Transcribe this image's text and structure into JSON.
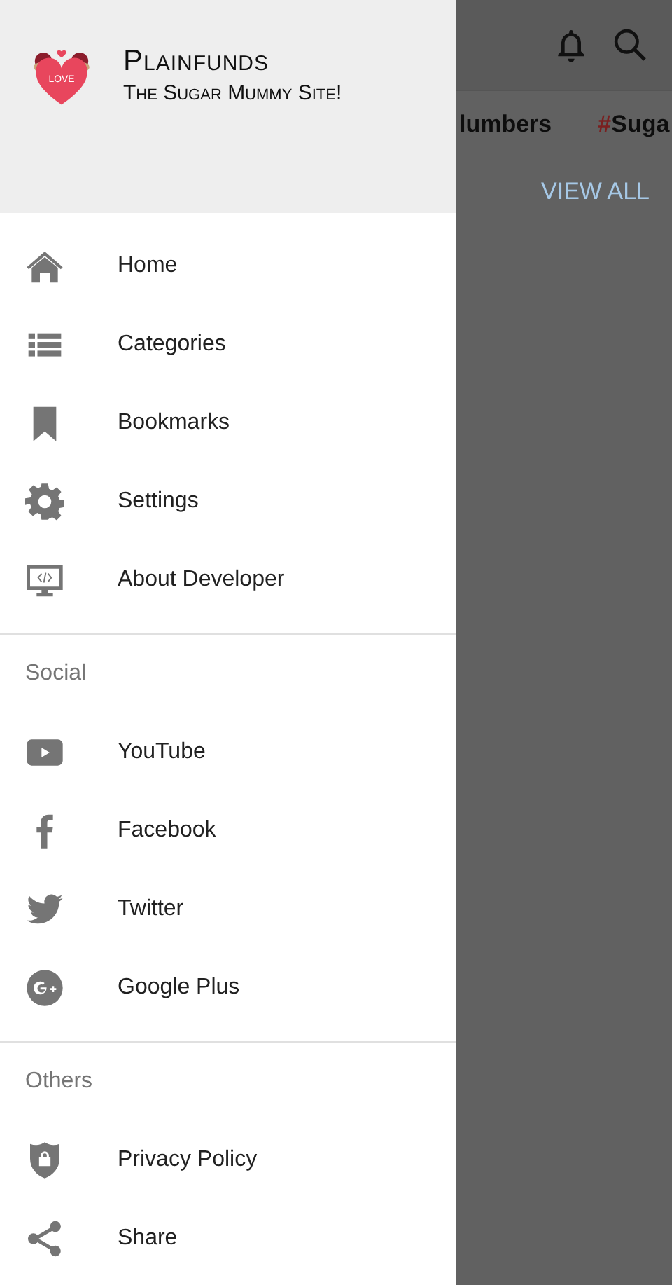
{
  "background": {
    "tags": [
      {
        "text": "lumbers"
      },
      {
        "prefix": "#",
        "text": "Suga"
      }
    ],
    "view_all": "VIEW ALL"
  },
  "drawer": {
    "header": {
      "logo_text": "LOVE",
      "title": "Plainfunds",
      "subtitle": "The Sugar Mummy Site!"
    },
    "sections": [
      {
        "items": [
          {
            "kind": "home",
            "label": "Home"
          },
          {
            "kind": "list",
            "label": "Categories"
          },
          {
            "kind": "bookmark",
            "label": "Bookmarks"
          },
          {
            "kind": "gear",
            "label": "Settings"
          },
          {
            "kind": "monitor",
            "label": "About Developer"
          }
        ]
      },
      {
        "title": "Social",
        "items": [
          {
            "kind": "play",
            "label": "YouTube"
          },
          {
            "kind": "facebook",
            "label": "Facebook"
          },
          {
            "kind": "bird",
            "label": "Twitter"
          },
          {
            "kind": "gplus",
            "label": "Google Plus"
          }
        ]
      },
      {
        "title": "Others",
        "items": [
          {
            "kind": "shield",
            "label": "Privacy Policy"
          },
          {
            "kind": "share",
            "label": "Share"
          }
        ]
      }
    ]
  }
}
